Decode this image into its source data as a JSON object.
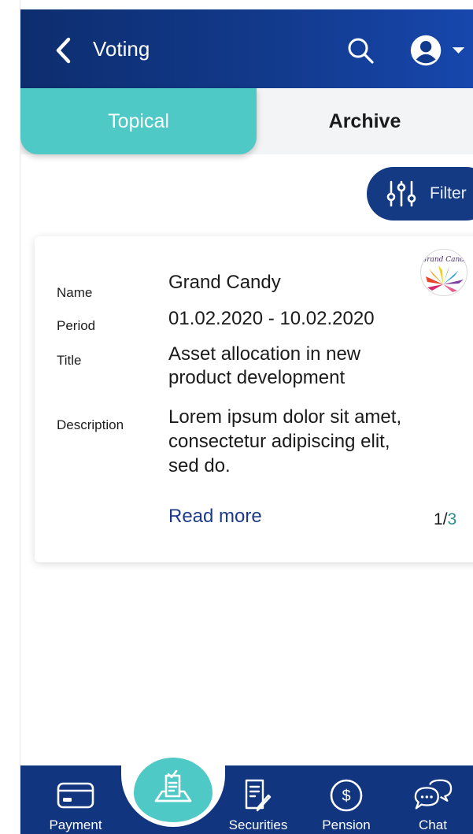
{
  "header": {
    "title": "Voting",
    "icons": {
      "back": "chevron-left-icon",
      "search": "search-icon",
      "profile": "user-circle-icon",
      "dropdown": "caret-down-icon"
    }
  },
  "tabs": [
    {
      "label": "Topical",
      "active": true
    },
    {
      "label": "Archive",
      "active": false
    }
  ],
  "filter": {
    "label": "Filter",
    "icon": "sliders-icon"
  },
  "card": {
    "logo_text": "Grand Candy",
    "rows": [
      {
        "label": "Name",
        "value": "Grand Candy"
      },
      {
        "label": "Period",
        "value": "01.02.2020 - 10.02.2020"
      },
      {
        "label": "Title",
        "value_line1": "Asset allocation in new",
        "value_line2": "product development"
      },
      {
        "label": "Description",
        "value_line1": "Lorem ipsum dolor sit amet,",
        "value_line2": "consectetur adipiscing elit,",
        "value_line3": "sed do."
      }
    ],
    "read_more": "Read more",
    "pager": {
      "current": "1",
      "separator": "/",
      "total": "3"
    }
  },
  "bottom_nav": {
    "center_icon": "ballot-box-icon",
    "items": [
      {
        "label": "Payment",
        "icon": "credit-card-icon"
      },
      {
        "label": "Securities",
        "icon": "document-pen-icon"
      },
      {
        "label": "Pension",
        "icon": "dollar-circle-icon"
      },
      {
        "label": "Chat",
        "icon": "chat-bubbles-icon"
      }
    ]
  },
  "colors": {
    "header_dark": "#0d2d6e",
    "header_light": "#1747ad",
    "accent_teal": "#4ec9c5",
    "nav_blue": "#123580",
    "link_blue": "#1d3a8a"
  }
}
